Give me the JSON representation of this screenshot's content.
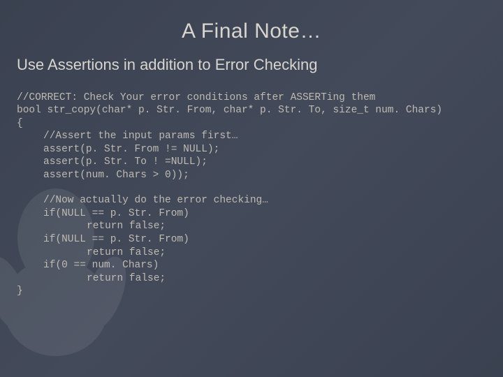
{
  "title": "A Final Note…",
  "subtitle": "Use Assertions in addition to Error Checking",
  "code": {
    "l1": "//CORRECT: Check Your error conditions after ASSERTing them",
    "l2": "bool str_copy(char* p. Str. From, char* p. Str. To, size_t num. Chars)",
    "l3": "{",
    "l4": "//Assert the input params first…",
    "l5": "assert(p. Str. From != NULL);",
    "l6": "assert(p. Str. To ! =NULL);",
    "l7": "assert(num. Chars > 0));",
    "l8": "//Now actually do the error checking…",
    "l9": "if(NULL == p. Str. From)",
    "l10": "return false;",
    "l11": "if(NULL == p. Str. From)",
    "l12": "return false;",
    "l13": "if(0 == num. Chars)",
    "l14": "return false;",
    "l15": "}"
  }
}
